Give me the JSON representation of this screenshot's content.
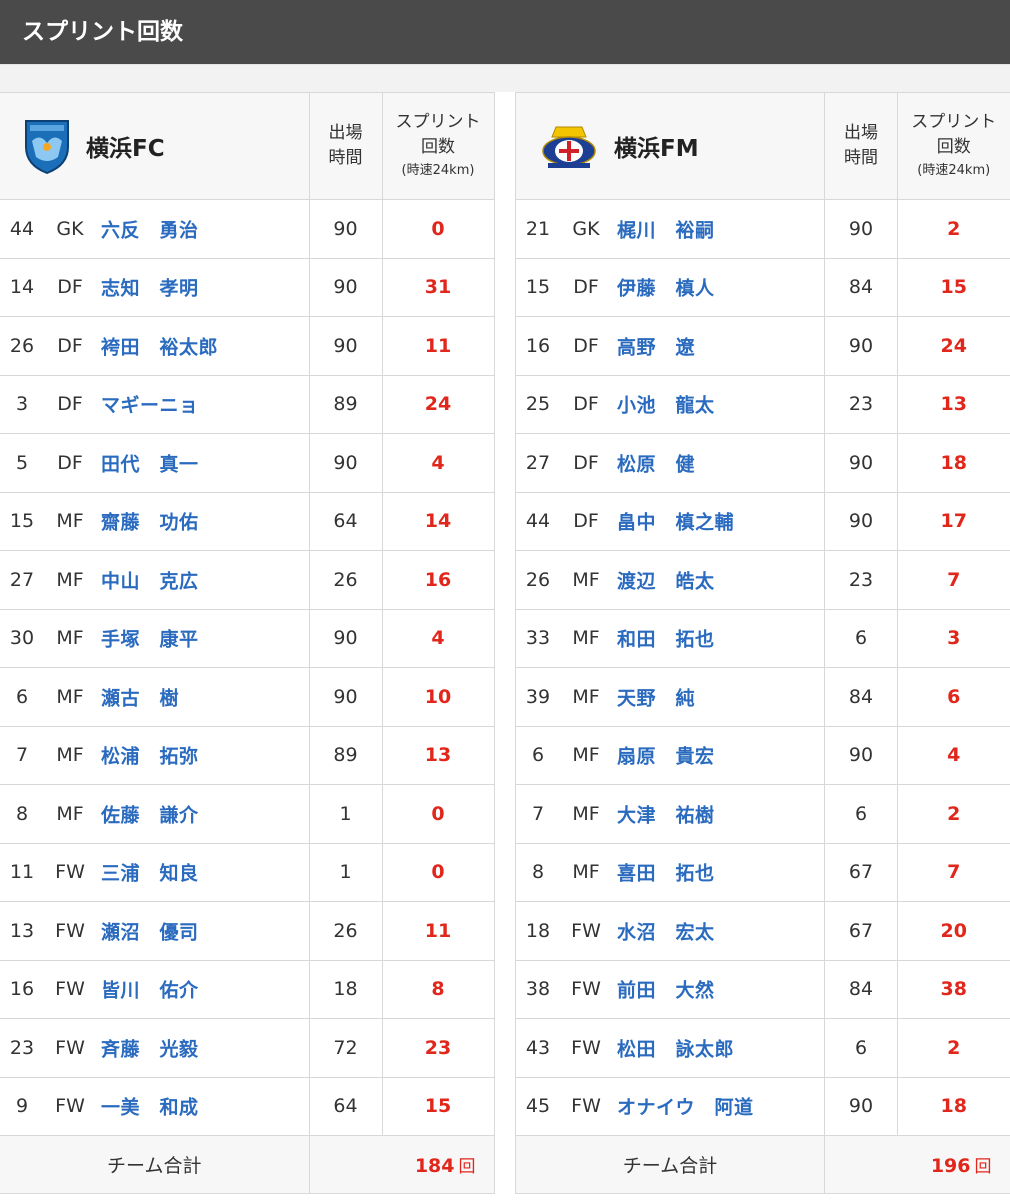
{
  "page_title": "スプリント回数",
  "headers": {
    "minutes": "出場\n時間",
    "sprint": "スプリント\n回数",
    "sprint_sub": "(時速24km)",
    "total_label": "チーム合計",
    "total_unit": "回"
  },
  "teams": [
    {
      "name": "横浜FC",
      "crest": "yokohama-fc-crest-icon",
      "total": "184",
      "players": [
        {
          "num": "44",
          "pos": "GK",
          "name": "六反　勇治",
          "min": "90",
          "sprints": "0"
        },
        {
          "num": "14",
          "pos": "DF",
          "name": "志知　孝明",
          "min": "90",
          "sprints": "31"
        },
        {
          "num": "26",
          "pos": "DF",
          "name": "袴田　裕太郎",
          "min": "90",
          "sprints": "11"
        },
        {
          "num": "3",
          "pos": "DF",
          "name": "マギーニョ",
          "min": "89",
          "sprints": "24"
        },
        {
          "num": "5",
          "pos": "DF",
          "name": "田代　真一",
          "min": "90",
          "sprints": "4"
        },
        {
          "num": "15",
          "pos": "MF",
          "name": "齋藤　功佑",
          "min": "64",
          "sprints": "14"
        },
        {
          "num": "27",
          "pos": "MF",
          "name": "中山　克広",
          "min": "26",
          "sprints": "16"
        },
        {
          "num": "30",
          "pos": "MF",
          "name": "手塚　康平",
          "min": "90",
          "sprints": "4"
        },
        {
          "num": "6",
          "pos": "MF",
          "name": "瀬古　樹",
          "min": "90",
          "sprints": "10"
        },
        {
          "num": "7",
          "pos": "MF",
          "name": "松浦　拓弥",
          "min": "89",
          "sprints": "13"
        },
        {
          "num": "8",
          "pos": "MF",
          "name": "佐藤　謙介",
          "min": "1",
          "sprints": "0"
        },
        {
          "num": "11",
          "pos": "FW",
          "name": "三浦　知良",
          "min": "1",
          "sprints": "0"
        },
        {
          "num": "13",
          "pos": "FW",
          "name": "瀬沼　優司",
          "min": "26",
          "sprints": "11"
        },
        {
          "num": "16",
          "pos": "FW",
          "name": "皆川　佑介",
          "min": "18",
          "sprints": "8"
        },
        {
          "num": "23",
          "pos": "FW",
          "name": "斉藤　光毅",
          "min": "72",
          "sprints": "23"
        },
        {
          "num": "9",
          "pos": "FW",
          "name": "一美　和成",
          "min": "64",
          "sprints": "15"
        }
      ]
    },
    {
      "name": "横浜FM",
      "crest": "yokohama-fm-crest-icon",
      "total": "196",
      "players": [
        {
          "num": "21",
          "pos": "GK",
          "name": "梶川　裕嗣",
          "min": "90",
          "sprints": "2"
        },
        {
          "num": "15",
          "pos": "DF",
          "name": "伊藤　槙人",
          "min": "84",
          "sprints": "15"
        },
        {
          "num": "16",
          "pos": "DF",
          "name": "高野　遼",
          "min": "90",
          "sprints": "24"
        },
        {
          "num": "25",
          "pos": "DF",
          "name": "小池　龍太",
          "min": "23",
          "sprints": "13"
        },
        {
          "num": "27",
          "pos": "DF",
          "name": "松原　健",
          "min": "90",
          "sprints": "18"
        },
        {
          "num": "44",
          "pos": "DF",
          "name": "畠中　槙之輔",
          "min": "90",
          "sprints": "17"
        },
        {
          "num": "26",
          "pos": "MF",
          "name": "渡辺　皓太",
          "min": "23",
          "sprints": "7"
        },
        {
          "num": "33",
          "pos": "MF",
          "name": "和田　拓也",
          "min": "6",
          "sprints": "3"
        },
        {
          "num": "39",
          "pos": "MF",
          "name": "天野　純",
          "min": "84",
          "sprints": "6"
        },
        {
          "num": "6",
          "pos": "MF",
          "name": "扇原　貴宏",
          "min": "90",
          "sprints": "4"
        },
        {
          "num": "7",
          "pos": "MF",
          "name": "大津　祐樹",
          "min": "6",
          "sprints": "2"
        },
        {
          "num": "8",
          "pos": "MF",
          "name": "喜田　拓也",
          "min": "67",
          "sprints": "7"
        },
        {
          "num": "18",
          "pos": "FW",
          "name": "水沼　宏太",
          "min": "67",
          "sprints": "20"
        },
        {
          "num": "38",
          "pos": "FW",
          "name": "前田　大然",
          "min": "84",
          "sprints": "38"
        },
        {
          "num": "43",
          "pos": "FW",
          "name": "松田　詠太郎",
          "min": "6",
          "sprints": "2"
        },
        {
          "num": "45",
          "pos": "FW",
          "name": "オナイウ　阿道",
          "min": "90",
          "sprints": "18"
        }
      ]
    }
  ]
}
